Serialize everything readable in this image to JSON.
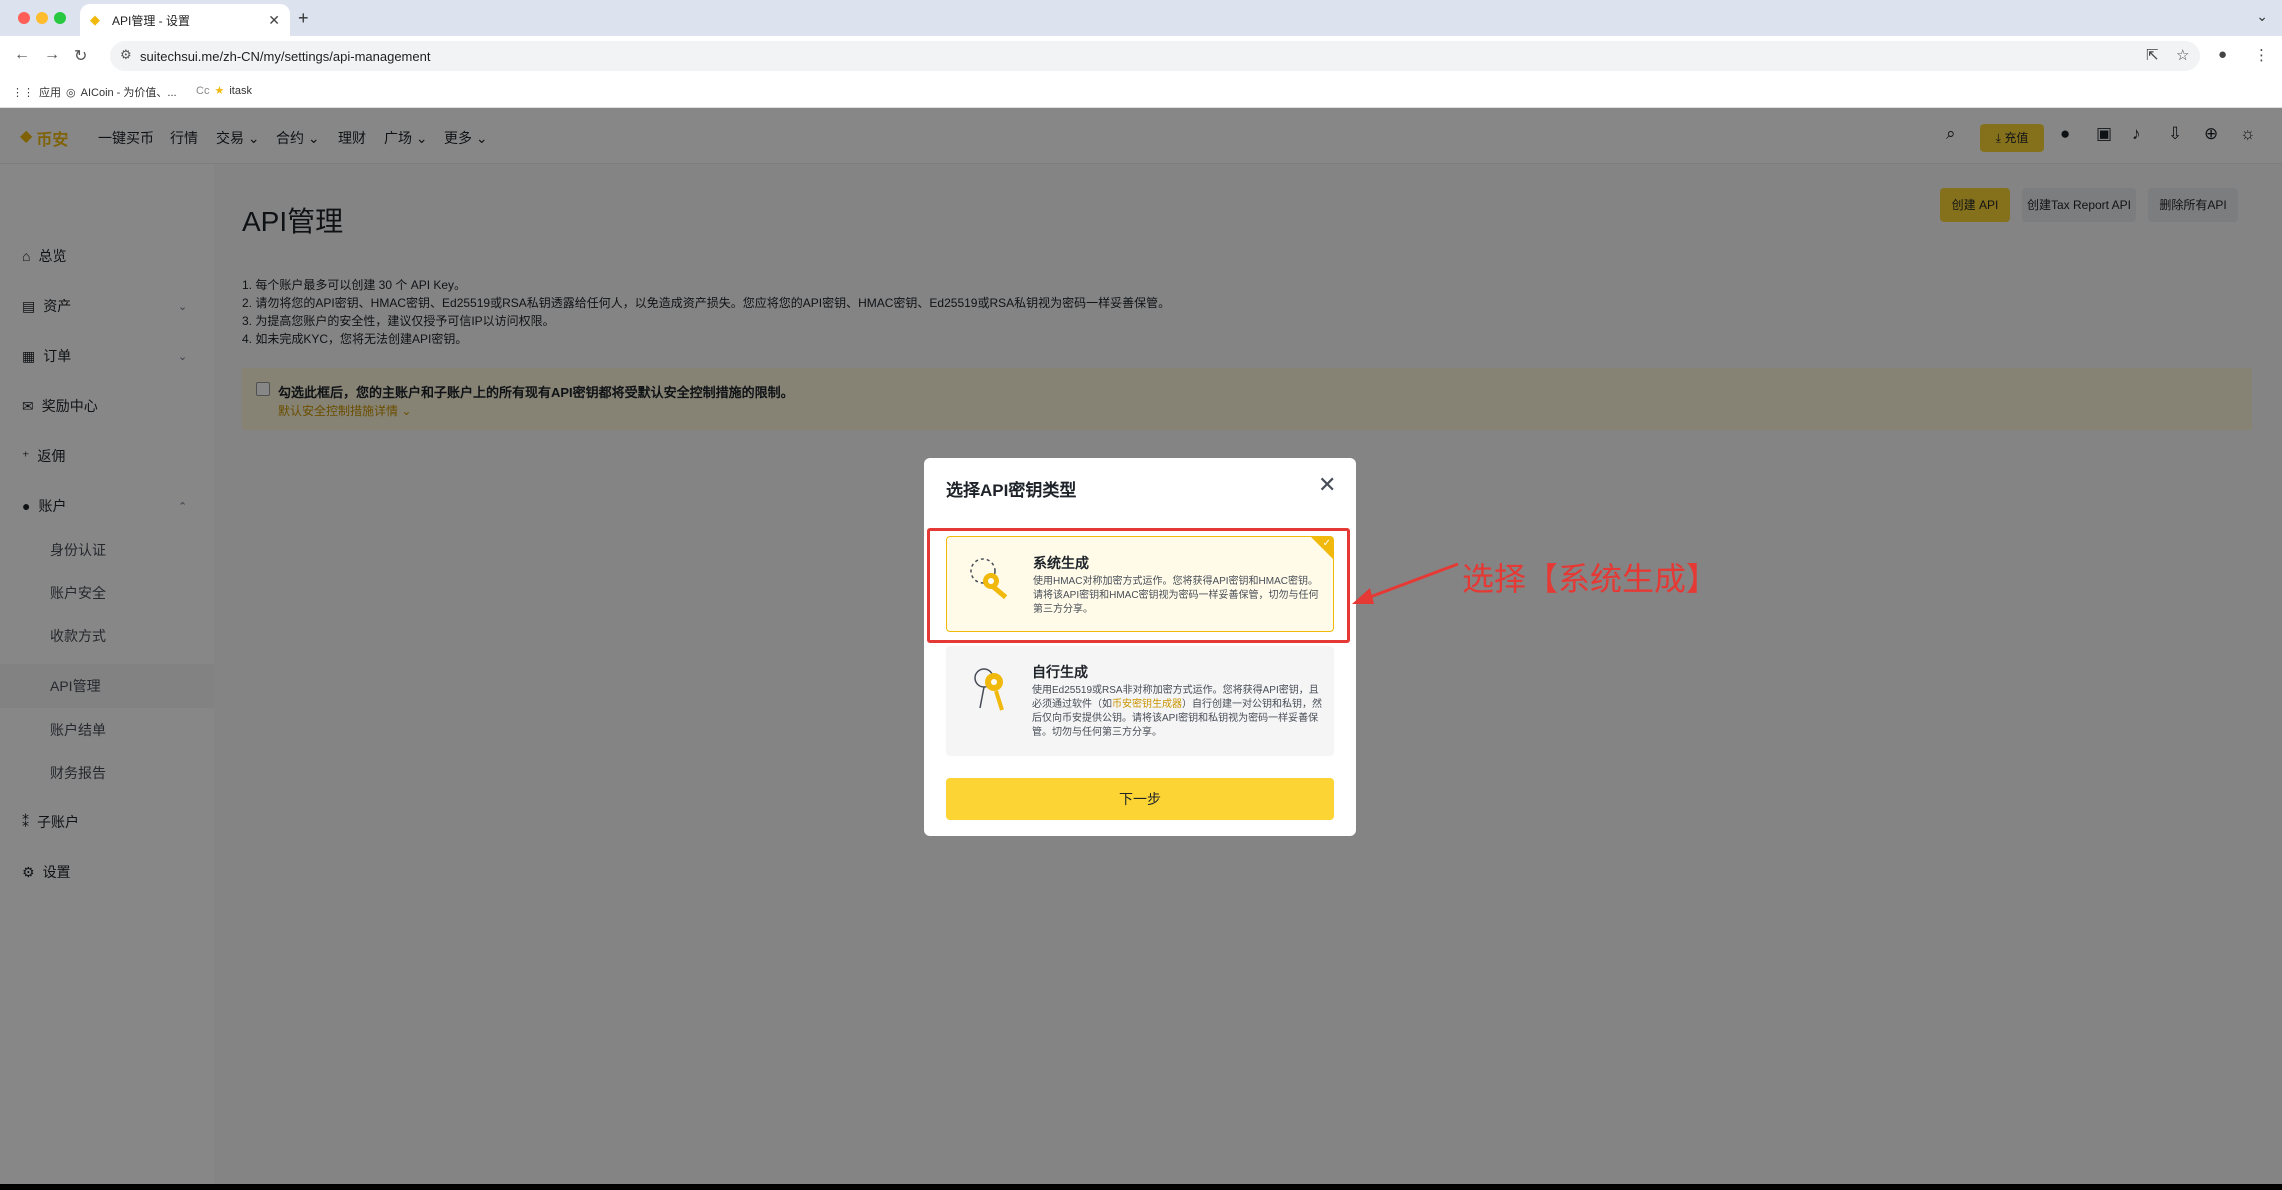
{
  "browser": {
    "tab_title": "API管理 - 设置",
    "url": "suitechsui.me/zh-CN/my/settings/api-management",
    "bookmarks": [
      "应用",
      "AICoin - 为价值、...",
      "itask"
    ],
    "bookmark_prefix": "Cc"
  },
  "topnav": {
    "logo": "币安",
    "items": [
      "一键买币",
      "行情",
      "交易",
      "合约",
      "理财",
      "广场",
      "更多"
    ],
    "deposit": "充值"
  },
  "sidebar": {
    "overview": "总览",
    "assets": "资产",
    "orders": "订单",
    "rewards": "奖励中心",
    "referral": "返佣",
    "account": "账户",
    "sub_items": [
      "身份认证",
      "账户安全",
      "收款方式",
      "API管理",
      "账户结单",
      "财务报告"
    ],
    "subaccount": "子账户",
    "settings": "设置"
  },
  "content": {
    "title": "API管理",
    "buttons": [
      "创建 API",
      "创建Tax Report API",
      "删除所有API"
    ],
    "notes": [
      "1. 每个账户最多可以创建 30 个 API Key。",
      "2. 请勿将您的API密钥、HMAC密钥、Ed25519或RSA私钥透露给任何人，以免造成资产损失。您应将您的API密钥、HMAC密钥、Ed25519或RSA私钥视为密码一样妥善保管。",
      "3. 为提高您账户的安全性，建议仅授予可信IP以访问权限。",
      "4. 如未完成KYC，您将无法创建API密钥。"
    ],
    "warning": "勾选此框后，您的主账户和子账户上的所有现有API密钥都将受默认安全控制措施的限制。",
    "warning_link": "默认安全控制措施详情"
  },
  "modal": {
    "title": "选择API密钥类型",
    "option1": {
      "title": "系统生成",
      "desc": "使用HMAC对称加密方式运作。您将获得API密钥和HMAC密钥。请将该API密钥和HMAC密钥视为密码一样妥善保管，切勿与任何第三方分享。"
    },
    "option2": {
      "title": "自行生成",
      "desc_before": "使用Ed25519或RSA非对称加密方式运作。您将获得API密钥，且必须通过软件（如",
      "desc_link": "币安密钥生成器",
      "desc_after": "）自行创建一对公钥和私钥，然后仅向币安提供公钥。请将该API密钥和私钥视为密码一样妥善保管。切勿与任何第三方分享。"
    },
    "next": "下一步"
  },
  "annotation": "选择【系统生成】",
  "colors": {
    "brand": "#f0b90b",
    "button": "#fcd535",
    "annotation": "#e53935"
  }
}
